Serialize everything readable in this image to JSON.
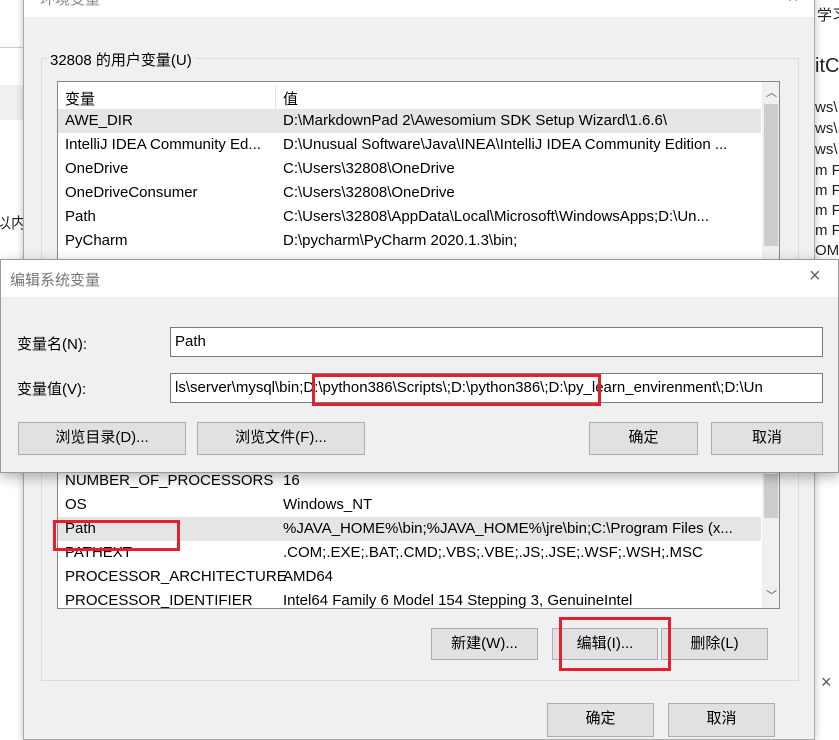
{
  "background_window": {
    "right_fragments": [
      "学习",
      "itC",
      "ws\\",
      "ws\\",
      "ws\\",
      "m F",
      "m F",
      "m F",
      "m F",
      "OM"
    ],
    "left_fragments": [
      "以内"
    ],
    "close_icon": "×"
  },
  "env_dialog": {
    "title": "环境变量",
    "user_group_label": "32808 的用户变量(U)",
    "columns": [
      "变量",
      "值"
    ],
    "user_vars": [
      {
        "name": "AWE_DIR",
        "value": "D:\\MarkdownPad 2\\Awesomium SDK Setup Wizard\\1.6.6\\"
      },
      {
        "name": "IntelliJ IDEA Community Ed...",
        "value": "D:\\Unusual Software\\Java\\INEA\\IntelliJ IDEA Community Edition ..."
      },
      {
        "name": "OneDrive",
        "value": "C:\\Users\\32808\\OneDrive"
      },
      {
        "name": "OneDriveConsumer",
        "value": "C:\\Users\\32808\\OneDrive"
      },
      {
        "name": "Path",
        "value": "C:\\Users\\32808\\AppData\\Local\\Microsoft\\WindowsApps;D:\\Un..."
      },
      {
        "name": "PyCharm",
        "value": "D:\\pycharm\\PyCharm 2020.1.3\\bin;"
      }
    ],
    "system_vars": [
      {
        "name": "NUMBER_OF_PROCESSORS",
        "value": "16"
      },
      {
        "name": "OS",
        "value": "Windows_NT"
      },
      {
        "name": "Path",
        "value": "%JAVA_HOME%\\bin;%JAVA_HOME%\\jre\\bin;C:\\Program Files (x..."
      },
      {
        "name": "PATHEXT",
        "value": ".COM;.EXE;.BAT;.CMD;.VBS;.VBE;.JS;.JSE;.WSF;.WSH;.MSC"
      },
      {
        "name": "PROCESSOR_ARCHITECTURE",
        "value": "AMD64"
      },
      {
        "name": "PROCESSOR_IDENTIFIER",
        "value": "Intel64 Family 6 Model 154 Stepping 3, GenuineIntel"
      }
    ],
    "buttons": {
      "new": "新建(W)...",
      "edit": "编辑(I)...",
      "delete": "删除(L)",
      "ok": "确定",
      "cancel": "取消"
    }
  },
  "edit_dialog": {
    "title": "编辑系统变量",
    "name_label": "变量名(N):",
    "name_value": "Path",
    "value_label": "变量值(V):",
    "value_before": "ls\\server\\mysql\\bin;",
    "value_highlight": "D:\\python386\\Scripts\\;D:\\python386\\;",
    "value_after": "D:\\py_learn_envirenment\\;D:\\Un",
    "buttons": {
      "browse_dir": "浏览目录(D)...",
      "browse_file": "浏览文件(F)...",
      "ok": "确定",
      "cancel": "取消"
    },
    "close_icon": "×"
  },
  "colors": {
    "highlight_red": "#e5202e",
    "dialog_bg": "#f0f0f0",
    "selected_row": "#e5e5e5"
  }
}
